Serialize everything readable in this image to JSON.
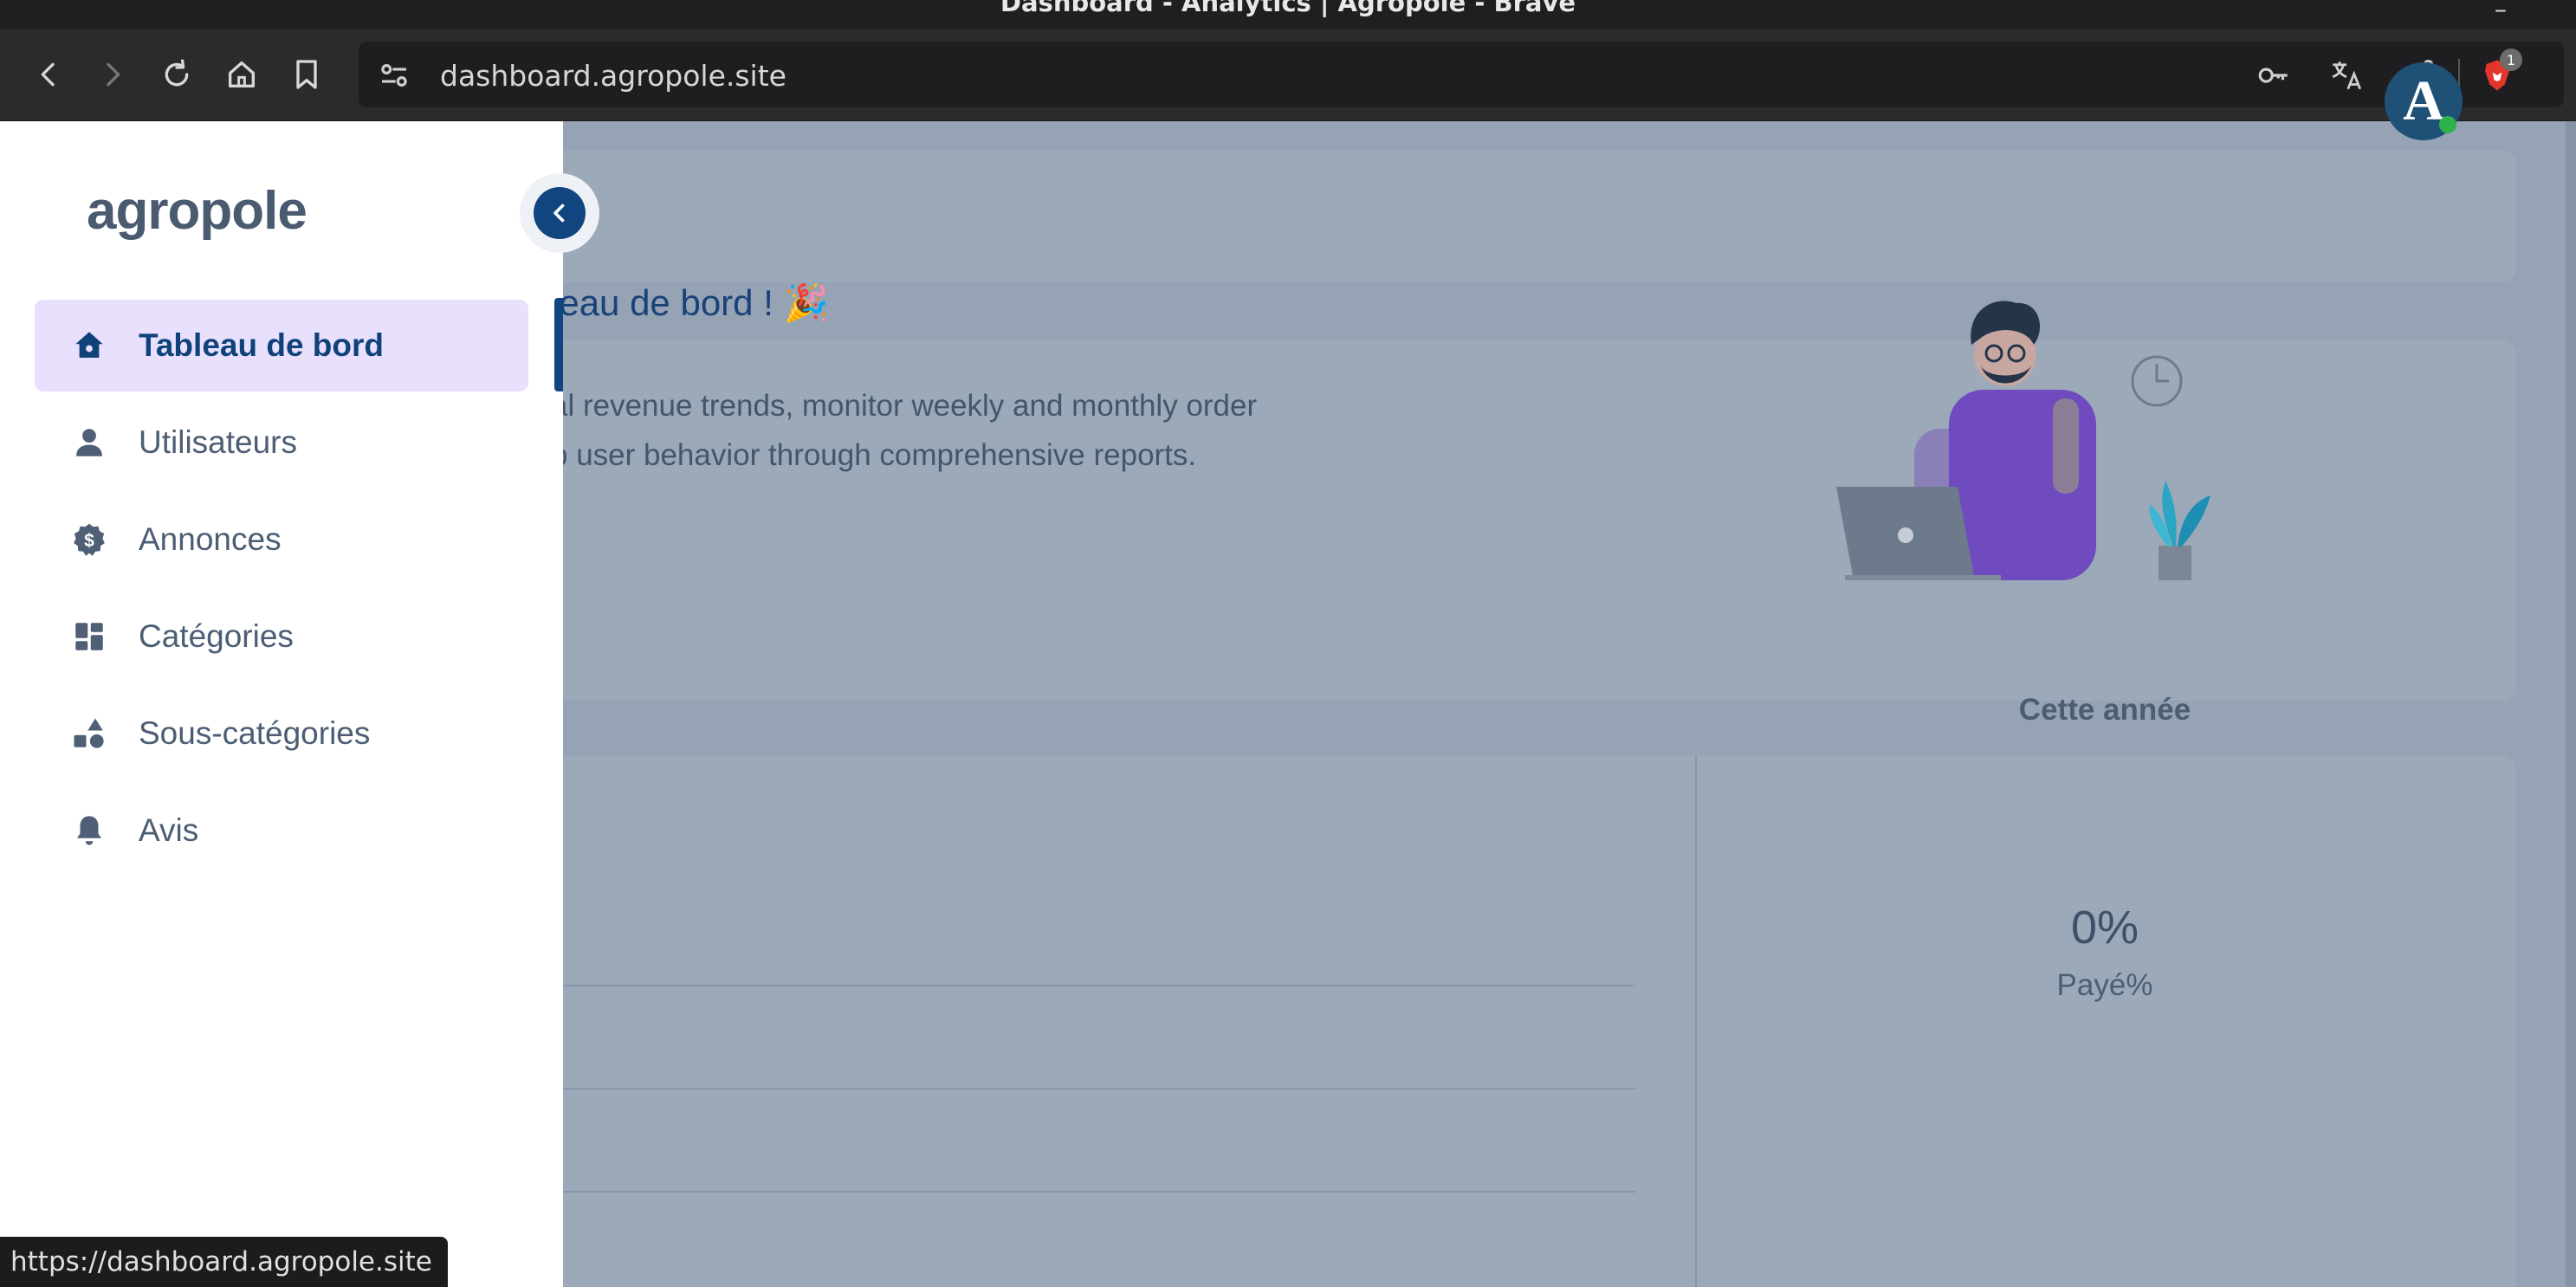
{
  "window": {
    "title": "Dashboard - Analytics | Agropole - Brave",
    "minimize": "–"
  },
  "browser": {
    "url": "dashboard.agropole.site",
    "shields_count": "1",
    "status_url": "https://dashboard.agropole.site"
  },
  "sidebar": {
    "brand": "agropole",
    "items": [
      {
        "label": "Tableau de bord",
        "icon": "home-icon",
        "active": true
      },
      {
        "label": "Utilisateurs",
        "icon": "user-icon"
      },
      {
        "label": "Annonces",
        "icon": "dollar-badge-icon"
      },
      {
        "label": "Catégories",
        "icon": "grid-icon"
      },
      {
        "label": "Sous-catégories",
        "icon": "shapes-icon"
      },
      {
        "label": "Avis",
        "icon": "bell-icon"
      }
    ]
  },
  "welcome": {
    "title": "leau de bord ! 🎉",
    "desc_line1": "al revenue trends, monitor weekly and monthly order",
    "desc_line2": "p user behavior through comprehensive reports."
  },
  "avatar": {
    "initial": "A"
  },
  "stats": {
    "year_title": "Cette année",
    "paid_value": "0%",
    "paid_label": "Payé%"
  },
  "colors": {
    "accent": "#10457f",
    "active_bg": "#e9e0fd",
    "overlay": "#96a3b4",
    "online": "#2db34a"
  }
}
